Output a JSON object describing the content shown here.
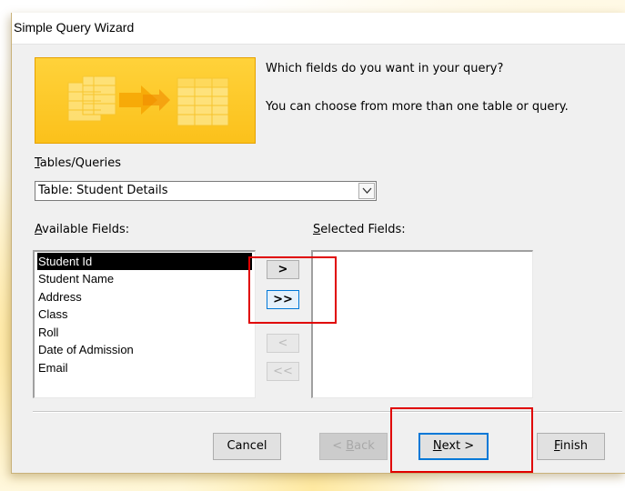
{
  "window": {
    "title": "Simple Query Wizard"
  },
  "prompt": {
    "line1": "Which fields do you want in your query?",
    "line2": "You can choose from more than one table or query."
  },
  "tables_queries": {
    "label_accel": "T",
    "label_rest": "ables/Queries",
    "selected": "Table: Student Details"
  },
  "available_fields": {
    "label_accel": "A",
    "label_rest": "vailable Fields:",
    "items": [
      "Student Id",
      "Student Name",
      "Address",
      "Class",
      "Roll",
      "Date of Admission",
      "Email"
    ],
    "selected_item": "Student Id"
  },
  "selected_fields": {
    "label_accel": "S",
    "label_rest": "elected Fields:",
    "items": []
  },
  "transfer_buttons": {
    "add_one": ">",
    "add_all": ">>",
    "remove_one": "<",
    "remove_all": "<<"
  },
  "footer": {
    "cancel": "Cancel",
    "back_pre": "< ",
    "back_accel": "B",
    "back_rest": "ack",
    "next_accel": "N",
    "next_rest": "ext >",
    "finish_accel": "F",
    "finish_rest": "inish"
  },
  "colors": {
    "highlight_annotation": "#e00000",
    "focus_blue": "#0078d7",
    "hero_yellow": "#fbc11b"
  }
}
